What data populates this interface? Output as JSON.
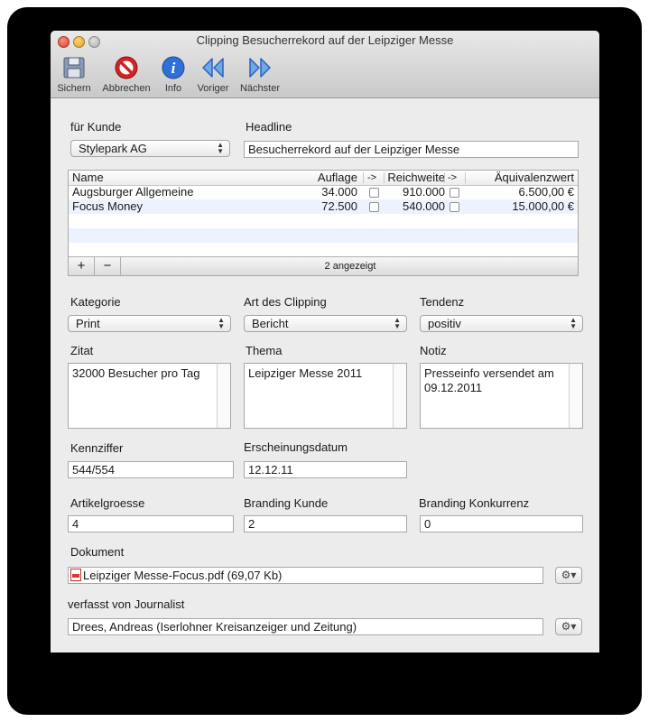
{
  "window": {
    "title": "Clipping Besucherrekord auf der Leipziger Messe"
  },
  "toolbar": {
    "save": "Sichern",
    "cancel": "Abbrechen",
    "info": "Info",
    "prev": "Voriger",
    "next": "Nächster"
  },
  "customer": {
    "label": "für Kunde",
    "value": "Stylepark AG"
  },
  "headline": {
    "label": "Headline",
    "value": "Besucherrekord auf der Leipziger Messe"
  },
  "table": {
    "columns": [
      "Name",
      "Auflage",
      "->",
      "Reichweite",
      "->",
      "Äquivalenzwert"
    ],
    "rows": [
      {
        "name": "Augsburger Allgemeine",
        "auflage": "34.000",
        "reichweite": "910.000",
        "wert": "6.500,00 €"
      },
      {
        "name": "Focus Money",
        "auflage": "72.500",
        "reichweite": "540.000",
        "wert": "15.000,00 €"
      }
    ],
    "add": "+",
    "remove": "−",
    "count": "2 angezeigt"
  },
  "kategorie": {
    "label": "Kategorie",
    "value": "Print"
  },
  "art": {
    "label": "Art des Clipping",
    "value": "Bericht"
  },
  "tendenz": {
    "label": "Tendenz",
    "value": "positiv"
  },
  "zitat": {
    "label": "Zitat",
    "value": "32000 Besucher pro Tag"
  },
  "thema": {
    "label": "Thema",
    "value": "Leipziger Messe 2011"
  },
  "notiz": {
    "label": "Notiz",
    "line1": "Presseinfo versendet am",
    "line2": "09.12.2011"
  },
  "kennziffer": {
    "label": "Kennziffer",
    "value": "544/554"
  },
  "datum": {
    "label": "Erscheinungsdatum",
    "value": "12.12.11"
  },
  "artikelgroesse": {
    "label": "Artikelgroesse",
    "value": "4"
  },
  "branding_kunde": {
    "label": "Branding Kunde",
    "value": "2"
  },
  "branding_konkurrenz": {
    "label": "Branding Konkurrenz",
    "value": "0"
  },
  "dokument": {
    "label": "Dokument",
    "value": "Leipziger Messe-Focus.pdf (69,07 Kb)"
  },
  "journalist": {
    "label": "verfasst von Journalist",
    "value": "Drees, Andreas (Iserlohner Kreisanzeiger und Zeitung)"
  },
  "icons": {
    "save": "floppy-disk-icon",
    "cancel": "no-entry-icon",
    "info": "info-icon",
    "prev": "rewind-icon",
    "next": "fast-forward-icon",
    "gear": "gear-icon",
    "pdf": "pdf-file-icon"
  },
  "colors": {
    "window_bg": "#ececec",
    "info_blue": "#2f6fd6",
    "cancel_red": "#d22424",
    "row_alt": "#edf3fe"
  }
}
